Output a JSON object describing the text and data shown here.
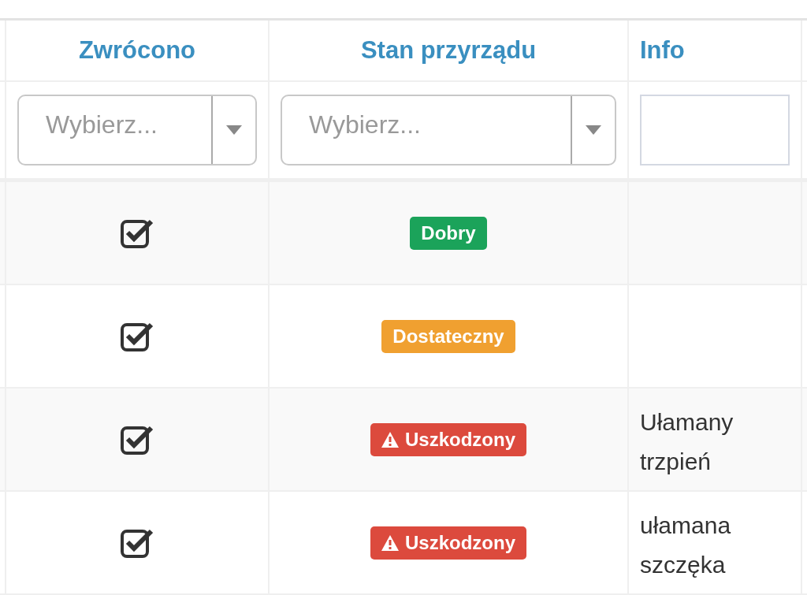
{
  "columns": [
    "Zwrócono",
    "Stan przyrządu",
    "Info"
  ],
  "filters": [
    {
      "kind": "select",
      "placeholder": "Wybierz..."
    },
    {
      "kind": "select",
      "placeholder": "Wybierz..."
    },
    {
      "kind": "text"
    }
  ],
  "rows": [
    {
      "returned": true,
      "status": {
        "label": "Dobry",
        "color": "#1ba35a",
        "warning": false
      },
      "info": ""
    },
    {
      "returned": true,
      "status": {
        "label": "Dostateczny",
        "color": "#f0a030",
        "warning": false
      },
      "info": ""
    },
    {
      "returned": true,
      "status": {
        "label": "Uszkodzony",
        "color": "#dc4a3d",
        "warning": true
      },
      "info": "Ułamany trzpień"
    },
    {
      "returned": true,
      "status": {
        "label": "Uszkodzony",
        "color": "#dc4a3d",
        "warning": true
      },
      "info": "ułamana szczęka"
    }
  ]
}
